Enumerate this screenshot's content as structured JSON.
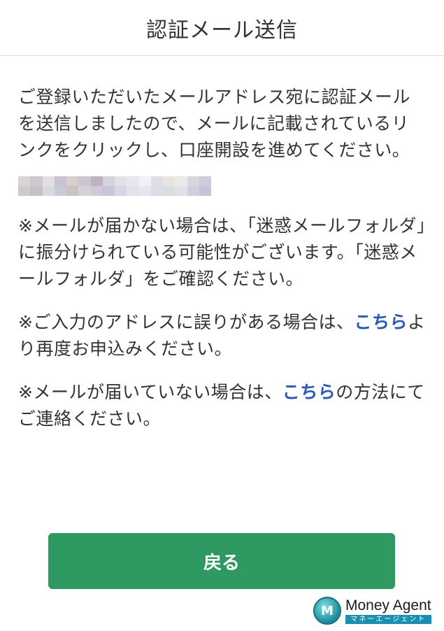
{
  "header": {
    "title": "認証メール送信"
  },
  "intro": "ご登録いただいたメールアドレス宛に認証メールを送信しましたので、メールに記載されているリンクをクリックし、口座開設を進めてください。",
  "notes": {
    "spam": "※メールが届かない場合は、「迷惑メールフォルダ」に振分けられている可能性がございます。「迷惑メールフォルダ」をご確認ください。",
    "wrong_address": {
      "prefix": "※ご入力のアドレスに誤りがある場合は、",
      "link": "こちら",
      "suffix": "より再度お申込みください。"
    },
    "not_received": {
      "prefix": "※メールが届いていない場合は、",
      "link": "こちら",
      "suffix": "の方法にてご連絡ください。"
    }
  },
  "back_button": {
    "label": "戻る"
  },
  "brand": {
    "mark": "M",
    "name": "Money Agent",
    "kana": "マネーエージェント"
  },
  "colors": {
    "accent": "#2e9960",
    "link": "#2a5ab5"
  }
}
